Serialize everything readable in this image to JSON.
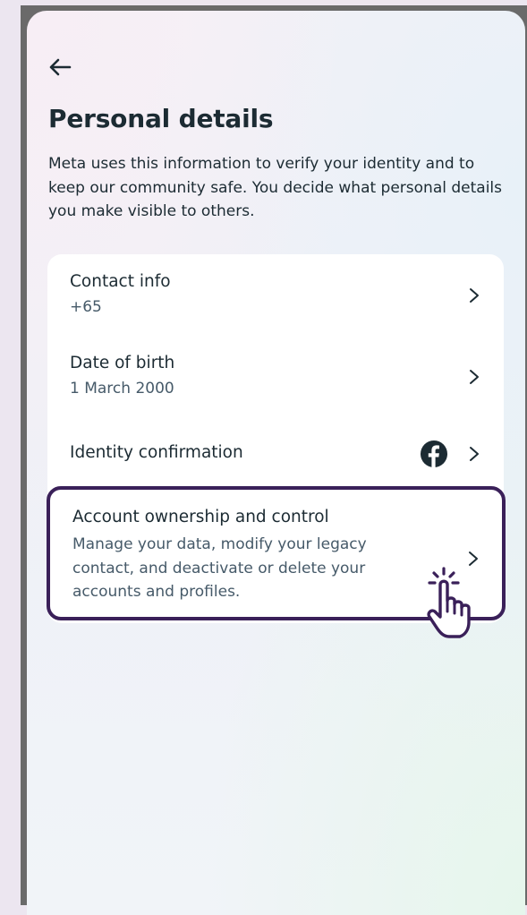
{
  "header": {
    "back_icon": "arrow-left-icon",
    "title": "Personal details",
    "description": "Meta uses this information to verify your identity and to keep our community safe. You decide what personal details you make visible to others."
  },
  "items": [
    {
      "title": "Contact info",
      "subtitle": "+65",
      "icon": "chevron-right-icon"
    },
    {
      "title": "Date of birth",
      "subtitle": "1 March 2000",
      "icon": "chevron-right-icon"
    },
    {
      "title": "Identity confirmation",
      "badge_icon": "facebook-icon",
      "icon": "chevron-right-icon"
    },
    {
      "title": "Account ownership and control",
      "subtitle": "Manage your data, modify your legacy contact, and deactivate or delete your accounts and profiles.",
      "icon": "chevron-right-icon"
    }
  ],
  "colors": {
    "text_primary": "#1c2b33",
    "text_secondary": "#465a69",
    "highlight_border": "#3a2059",
    "facebook_badge": "#1c2b33"
  }
}
